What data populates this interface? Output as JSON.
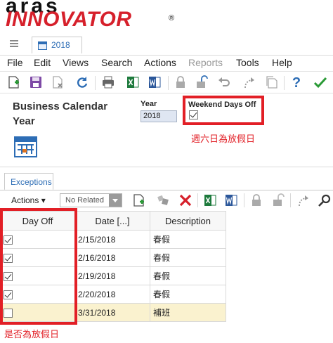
{
  "logo": {
    "top": "aras",
    "bottom": "INNOVATOR",
    "mark": "®"
  },
  "item_tab": {
    "label": "2018",
    "icon": "calendar-icon"
  },
  "menu": [
    {
      "label": "File",
      "disabled": false
    },
    {
      "label": "Edit",
      "disabled": false
    },
    {
      "label": "Views",
      "disabled": false
    },
    {
      "label": "Search",
      "disabled": false
    },
    {
      "label": "Actions",
      "disabled": false
    },
    {
      "label": "Reports",
      "disabled": true
    },
    {
      "label": "Tools",
      "disabled": false
    },
    {
      "label": "Help",
      "disabled": false
    }
  ],
  "toolbar_icons": [
    "new-icon",
    "save-icon",
    "discard-icon",
    "refresh-icon",
    "print-icon",
    "export-excel-icon",
    "export-word-icon",
    "lock-icon",
    "unlock-icon",
    "undo-icon",
    "promote-icon",
    "copy-icon",
    "help-icon",
    "done-icon"
  ],
  "form": {
    "item_type_title": "Business Calendar Year",
    "year_label": "Year",
    "year_value": "2018",
    "weekend_label": "Weekend Days Off",
    "weekend_checked": true,
    "weekend_annotation": "週六日為放假日"
  },
  "relationships": {
    "tab_label": "Exceptions",
    "actions_label": "Actions",
    "related_select": "No Related",
    "columns": [
      "Day Off",
      "Date [...]",
      "Description"
    ],
    "rows": [
      {
        "day_off": true,
        "date": "2/15/2018",
        "description": "春假"
      },
      {
        "day_off": true,
        "date": "2/16/2018",
        "description": "春假"
      },
      {
        "day_off": true,
        "date": "2/19/2018",
        "description": "春假"
      },
      {
        "day_off": true,
        "date": "2/20/2018",
        "description": "春假"
      },
      {
        "day_off": false,
        "date": "3/31/2018",
        "description": "補班"
      }
    ],
    "day_off_annotation": "是否為放假日"
  },
  "colors": {
    "brand_red": "#d6202b",
    "annotation_red": "#e21f26",
    "accent_blue": "#2d6db5",
    "selected_row": "#faf2cf"
  }
}
